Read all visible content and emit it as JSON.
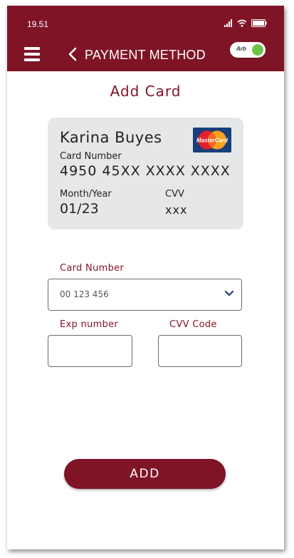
{
  "status_bar": {
    "time": "19.51"
  },
  "header": {
    "title": "PAYMENT METHOD",
    "language_toggle": "Arb"
  },
  "page": {
    "title": "Add Card"
  },
  "card": {
    "holder": "Karina Buyes",
    "brand_logo_text": "MasterCard",
    "number_label": "Card Number",
    "number": "4950 45XX XXXX XXXX",
    "month_year_label": "Month/Year",
    "month_year": "01/23",
    "cvv_label": "CVV",
    "cvv": "xxx"
  },
  "form": {
    "card_number_label": "Card Number",
    "card_number_value": "00 123 456",
    "exp_label": "Exp number",
    "exp_value": "",
    "cvv_label": "CVV Code",
    "cvv_value": ""
  },
  "actions": {
    "add_label": "ADD"
  },
  "colors": {
    "primary": "#7f1427",
    "card_bg": "#e6e7e9",
    "toggle_on": "#6cc24a"
  },
  "icons": [
    "hamburger-menu-icon",
    "chevron-left-icon",
    "signal-icon",
    "wifi-icon",
    "battery-icon",
    "mastercard-logo",
    "chevron-down-icon"
  ]
}
